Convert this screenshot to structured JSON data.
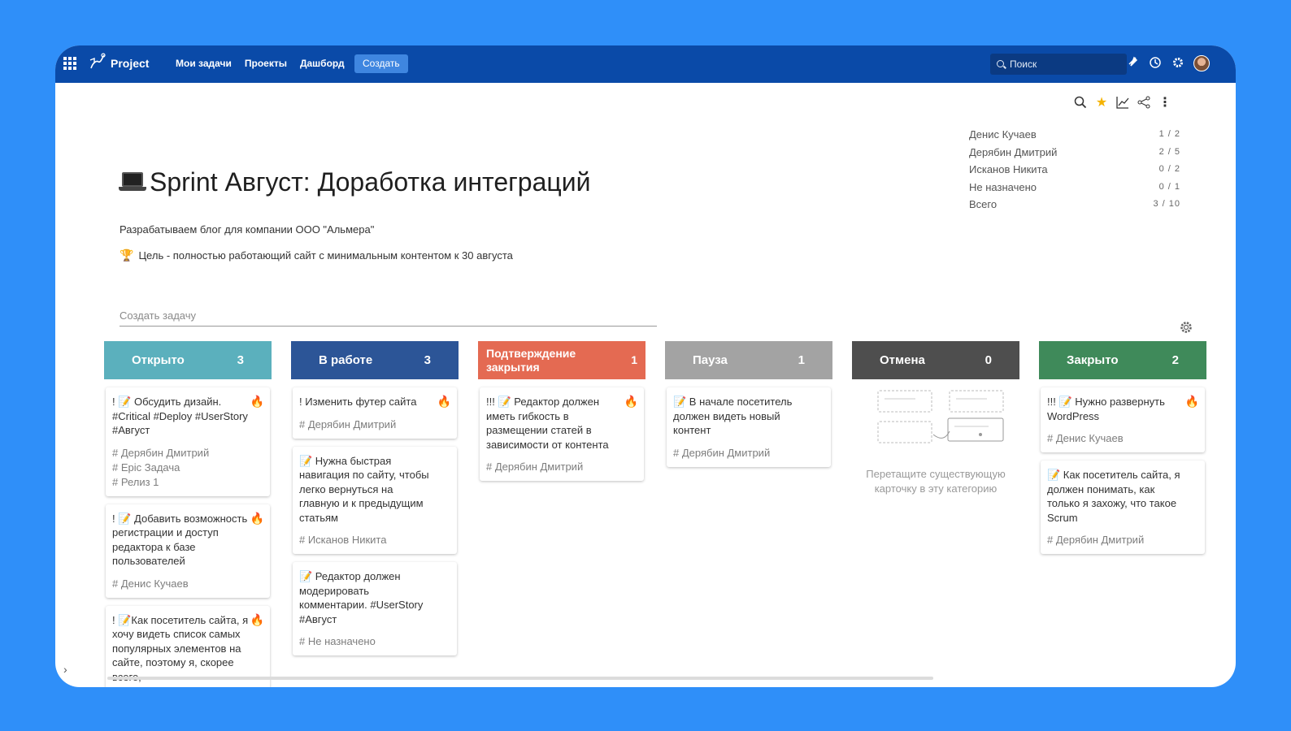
{
  "topbar": {
    "logo": "Project",
    "nav": [
      "Мои задачи",
      "Проекты",
      "Дашборд"
    ],
    "create_label": "Создать",
    "search_placeholder": "Поиск",
    "icons": [
      "bell-icon",
      "history-icon",
      "settings-icon"
    ]
  },
  "assignee_stats": [
    {
      "name": "Денис Кучаев",
      "value": "1 /  2"
    },
    {
      "name": "Дерябин Дмитрий",
      "value": "2 /  5"
    },
    {
      "name": "Исканов Никита",
      "value": "0 /  2"
    },
    {
      "name": "Не назначено",
      "value": "0 /  1"
    },
    {
      "name": "Всего",
      "value": "3 / 10"
    }
  ],
  "sprint": {
    "title": "Sprint Август: Доработка интеграций",
    "description": "Разрабатываем блог для компании ООО \"Альмера\"",
    "goal": "Цель - полностью работающий сайт с минимальным контентом к 30 августа"
  },
  "create_task_placeholder": "Создать задачу",
  "columns": [
    {
      "title": "Открыто",
      "count": "3",
      "color": "#5bb0bd",
      "cards": [
        {
          "text": "! 📝 Обсудить дизайн. #Critical #Deploy #UserStory #Август",
          "meta": [
            "# Дерябин Дмитрий",
            "# Epic Задача",
            "# Релиз 1"
          ],
          "flame": "orange"
        },
        {
          "text": "! 📝 Добавить возможность регистрации и доступ редактора к базе пользователей",
          "meta": [
            "# Денис Кучаев"
          ],
          "flame": "orange"
        },
        {
          "text": "! 📝Как посетитель сайта, я хочу видеть список самых популярных элементов на сайте, поэтому я, скорее всего,",
          "meta": [],
          "flame": "orange"
        }
      ]
    },
    {
      "title": "В работе",
      "count": "3",
      "color": "#2c5597",
      "cards": [
        {
          "text": "! Изменить футер сайта",
          "meta": [
            "# Дерябин Дмитрий"
          ],
          "flame": "orange"
        },
        {
          "text": "📝 Нужна быстрая навигация по сайту, чтобы легко вернуться на главную и к предыдущим статьям",
          "meta": [
            "# Исканов Никита"
          ],
          "flame": ""
        },
        {
          "text": "📝 Редактор должен модерировать комментарии. #UserStory #Август",
          "meta": [
            "# Не назначено"
          ],
          "flame": ""
        }
      ]
    },
    {
      "title": "Подтверждение закрытия",
      "count": "1",
      "color": "#e46a52",
      "cards": [
        {
          "text": "!!! 📝 Редактор должен иметь гибкость в размещении статей в зависимости от контента",
          "meta": [
            "# Дерябин Дмитрий"
          ],
          "flame": "red"
        }
      ]
    },
    {
      "title": "Пауза",
      "count": "1",
      "color": "#a3a3a3",
      "cards": [
        {
          "text": "📝 В начале посетитель должен видеть новый контент",
          "meta": [
            "# Дерябин Дмитрий"
          ],
          "flame": ""
        }
      ]
    },
    {
      "title": "Отмена",
      "count": "0",
      "color": "#4e4e4e",
      "cards": [],
      "empty_hint": "Перетащите существующую карточку в эту категорию"
    },
    {
      "title": "Закрыто",
      "count": "2",
      "color": "#3f8a5a",
      "cards": [
        {
          "text": "!!! 📝 Нужно развернуть WordPress",
          "meta": [
            "# Денис Кучаев"
          ],
          "flame": "red"
        },
        {
          "text": "📝 Как посетитель сайта, я должен понимать, как только я захожу, что такое Scrum",
          "meta": [
            "# Дерябин Дмитрий"
          ],
          "flame": ""
        }
      ]
    }
  ]
}
